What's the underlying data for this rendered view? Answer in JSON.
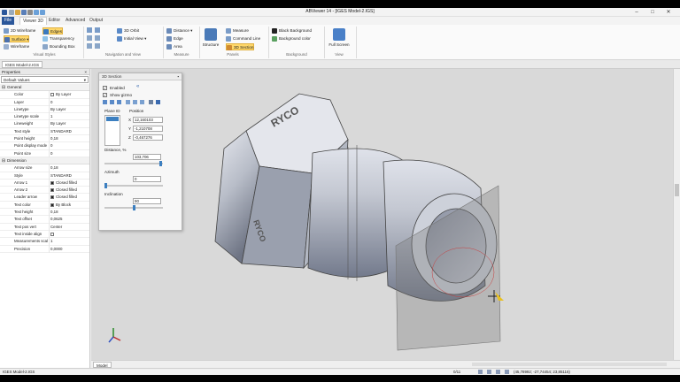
{
  "window": {
    "title": "ABViewer 14 - [IGES Model-2.IGS]"
  },
  "ribbon_tabs": [
    "File",
    "Viewer 3D",
    "Editor",
    "Advanced",
    "Output"
  ],
  "ribbon": {
    "visual_styles": {
      "items": [
        "2D Wireframe",
        "Surface",
        "Wireframe",
        "Edges",
        "Transparency",
        "Bounding Box"
      ],
      "group_label": "Visual Styles"
    },
    "navigation": {
      "items": [
        "3D Orbit",
        "Initial View"
      ],
      "group_label": "Navigation and View"
    },
    "measure": {
      "items": [
        "Distance",
        "Edge",
        "Area"
      ],
      "group_label": "Measure"
    },
    "panels": {
      "structure": "Structure",
      "items": [
        "Measure",
        "Command Line",
        "3D Section"
      ],
      "group_label": "Panels"
    },
    "background": {
      "items": [
        "Black Background",
        "Background color"
      ],
      "group_label": "Background"
    },
    "view": {
      "full_screen": "Full Screen",
      "group_label": "View"
    }
  },
  "doc_tab": "IGES Model-2.IGS",
  "properties": {
    "header": "Properties",
    "selector": "Default Values",
    "categories": [
      {
        "name": "General",
        "rows": [
          {
            "k": "Color",
            "v": "By Layer",
            "swatch": "#ffffff"
          },
          {
            "k": "Layer",
            "v": "0"
          },
          {
            "k": "Linetype",
            "v": "By Layer"
          },
          {
            "k": "Linetype scale",
            "v": "1"
          },
          {
            "k": "Lineweight",
            "v": "By Layer"
          },
          {
            "k": "Text style",
            "v": "STANDARD"
          },
          {
            "k": "Point height",
            "v": "0,18"
          },
          {
            "k": "Point display mode",
            "v": "0"
          },
          {
            "k": "Point size",
            "v": "0"
          }
        ]
      },
      {
        "name": "Dimension",
        "rows": [
          {
            "k": "Arrow size",
            "v": "0,18"
          },
          {
            "k": "Style",
            "v": "STANDARD"
          },
          {
            "k": "Arrow 1",
            "v": "Closed filled",
            "swatch": "#222222"
          },
          {
            "k": "Arrow 2",
            "v": "Closed filled",
            "swatch": "#222222"
          },
          {
            "k": "Leader arrow",
            "v": "Closed filled",
            "swatch": "#222222"
          },
          {
            "k": "Text color",
            "v": "By Block",
            "swatch": "#222222"
          },
          {
            "k": "Text height",
            "v": "0,18"
          },
          {
            "k": "Text offset",
            "v": "0,0625"
          },
          {
            "k": "Text pos vert",
            "v": "Center"
          },
          {
            "k": "Text inside align",
            "v": ""
          },
          {
            "k": "Measurements scal",
            "v": "1"
          },
          {
            "k": "Precision",
            "v": "0,0000"
          }
        ]
      }
    ]
  },
  "section_panel": {
    "title": "3D Section",
    "enabled_label": "Enabled",
    "show_gizmo_label": "Show gizmo",
    "plane_id_label": "Plane ID",
    "position_label": "Position",
    "x_label": "X",
    "x_value": "12,160103",
    "y_label": "Y",
    "y_value": "-1,210708",
    "z_label": "Z",
    "z_value": "-0,467276",
    "distance_label": "Distance, %",
    "distance_value": "103,706",
    "azimuth_label": "Azimuth",
    "azimuth_value": "0",
    "inclination_label": "Inclination",
    "inclination_value": "90"
  },
  "model_text": {
    "brand": "RYCO"
  },
  "model_tab": "Model",
  "status": {
    "file": "IGES Model-2.IGS",
    "page": "0/11",
    "coords": "(45,78992; -27,74454; 23,85116)"
  },
  "colors": {
    "file_tab": "#2b579a",
    "selected_button": "#ffd86b",
    "viewport_bg": "#d9d9d9",
    "part_metal": "#b8bdc8"
  }
}
